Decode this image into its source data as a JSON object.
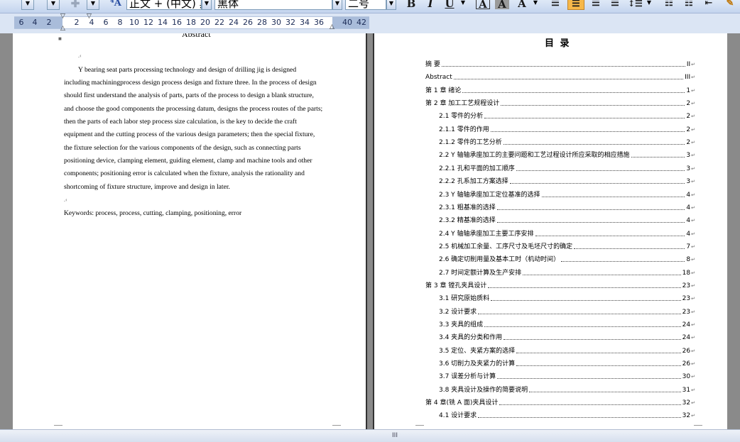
{
  "toolbar": {
    "style_value": "正文 + (中文) 黑",
    "font_value": "黑体",
    "size_value": "二号",
    "bold_label": "B",
    "italic_label": "I",
    "underline_label": "U",
    "font_color_label": "A",
    "highlight_label": "A",
    "char_shade_label": "A",
    "icons": [
      "bold-icon",
      "italic-icon",
      "underline-icon",
      "font-color-icon",
      "highlight-icon",
      "align-left-icon",
      "align-center-icon",
      "align-right-icon",
      "justify-icon",
      "line-spacing-icon",
      "numbering-icon",
      "bullets-icon"
    ],
    "active_color": "#f6b84a"
  },
  "ruler": {
    "left_ticks": [
      "6",
      "4",
      "2",
      "2",
      "4",
      "6",
      "8",
      "10",
      "12",
      "14",
      "16",
      "18",
      "20",
      "22",
      "24",
      "26",
      "28",
      "30",
      "32",
      "34",
      "36",
      "40",
      "42"
    ]
  },
  "left_page": {
    "heading": "Abstract",
    "marks": [
      ".‹",
      ".‹"
    ],
    "abstract_lines": [
      "Y bearing seat parts processing technology and design of drilling jig is designed",
      "including machiningprocess design process design and fixture three. In the process of design",
      "should first understand the analysis of parts, parts of the process to design a blank structure,",
      "and choose the good components the processing datum, designs the process routes of the parts;",
      "then the parts of each labor step process size calculation, is the key to decide the craft",
      "equipment and the cutting process of the various design parameters; then the special fixture,",
      "the fixture selection for the various components of the design, such as connecting parts",
      "positioning device, clamping element, guiding element, clamp and machine tools and other",
      "components; positioning error is calculated when the fixture, analysis the rationality and",
      "shortcoming of fixture structure, improve and design in later."
    ],
    "keywords": "Keywords: process, process, cutting, clamping, positioning, error"
  },
  "right_page": {
    "toc_title": "目  录",
    "toc": [
      {
        "label": "摘  要",
        "page": "II",
        "level": 1
      },
      {
        "label": "Abstract",
        "page": "III",
        "level": 1
      },
      {
        "label": "第 1 章  绪论",
        "page": "1",
        "level": 1
      },
      {
        "label": "第 2 章  加工工艺规程设计",
        "page": "2",
        "level": 1
      },
      {
        "label": "2.1  零件的分析",
        "page": "2",
        "level": 2
      },
      {
        "label": "2.1.1  零件的作用",
        "page": "2",
        "level": 2
      },
      {
        "label": "2.1.2  零件的工艺分析",
        "page": "2",
        "level": 2
      },
      {
        "label": "2.2 Y 轴轴承座加工的主要问题和工艺过程设计所应采取的相应措施",
        "page": "3",
        "level": 2
      },
      {
        "label": "2.2.1  孔和平面的加工顺序",
        "page": "3",
        "level": 2
      },
      {
        "label": "2.2.2  孔系加工方案选择",
        "page": "3",
        "level": 2
      },
      {
        "label": "2.3 Y 轴轴承座加工定位基准的选择",
        "page": "4",
        "level": 2
      },
      {
        "label": "2.3.1  粗基准的选择",
        "page": "4",
        "level": 2
      },
      {
        "label": "2.3.2  精基准的选择",
        "page": "4",
        "level": 2
      },
      {
        "label": "2.4 Y 轴轴承座加工主要工序安排",
        "page": "4",
        "level": 2
      },
      {
        "label": "2.5  机械加工余量、工序尺寸及毛坯尺寸的确定",
        "page": "7",
        "level": 2
      },
      {
        "label": "2.6 确定切削用量及基本工时（机动时间）",
        "page": "8",
        "level": 2
      },
      {
        "label": "2.7  时间定额计算及生产安排",
        "page": "18",
        "level": 2
      },
      {
        "label": "第 3 章  镗孔夹具设计",
        "page": "23",
        "level": 1
      },
      {
        "label": "3.1  研究原始质料",
        "page": "23",
        "level": 2
      },
      {
        "label": "3.2  设计要求",
        "page": "23",
        "level": 2
      },
      {
        "label": "3.3  夹具的组成",
        "page": "24",
        "level": 2
      },
      {
        "label": "3.4  夹具的分类和作用",
        "page": "24",
        "level": 2
      },
      {
        "label": "3.5  定位、夹紧方案的选择",
        "page": "26",
        "level": 2
      },
      {
        "label": "3.6  切削力及夹紧力的计算",
        "page": "26",
        "level": 2
      },
      {
        "label": "3.7  误差分析与计算",
        "page": "30",
        "level": 2
      },
      {
        "label": "3.8  夹具设计及操作的简要说明",
        "page": "31",
        "level": 2
      },
      {
        "label": "第 4 章(铣 A 面)夹具设计",
        "page": "32",
        "level": 1
      },
      {
        "label": "4.1 设计要求",
        "page": "32",
        "level": 2
      }
    ]
  },
  "scrollbar": {
    "thumb_glyph": "III"
  }
}
